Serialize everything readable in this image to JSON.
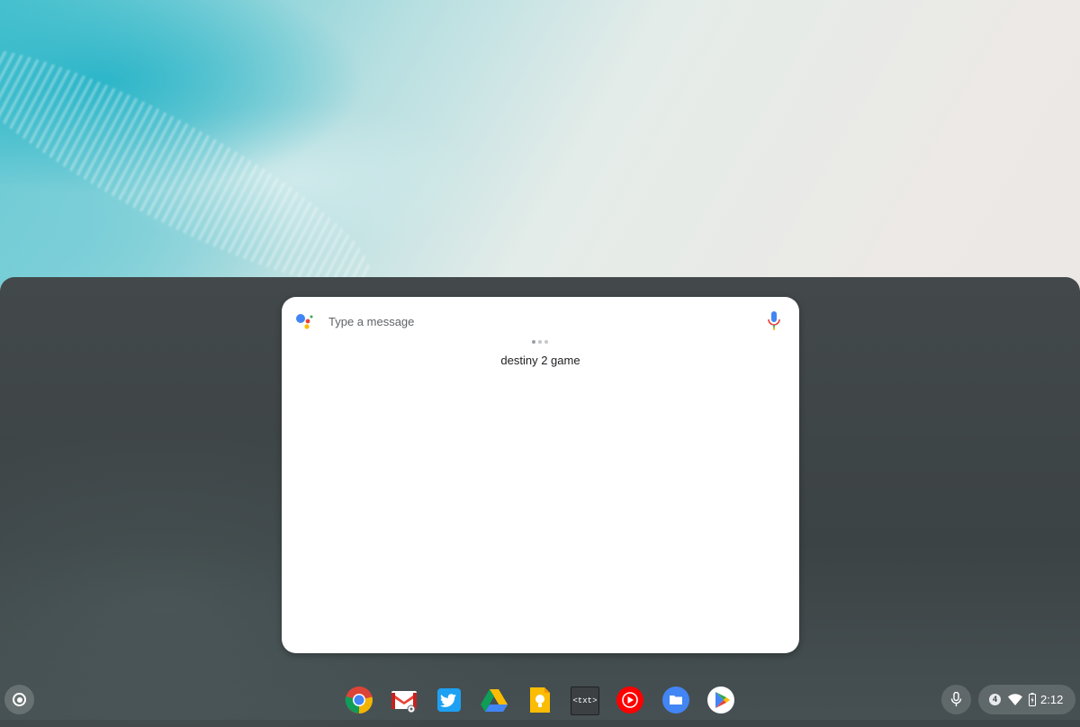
{
  "assistant": {
    "input_placeholder": "Type a message",
    "query": "destiny 2 game",
    "mic_icon": "mic-icon",
    "logo_icon": "google-assistant-icon"
  },
  "shelf": {
    "launcher_icon": "launcher-circle-icon",
    "apps": [
      {
        "name": "Chrome",
        "icon": "chrome-icon"
      },
      {
        "name": "Gmail",
        "icon": "gmail-icon"
      },
      {
        "name": "Twitter",
        "icon": "twitter-icon"
      },
      {
        "name": "Google Drive",
        "icon": "drive-icon"
      },
      {
        "name": "Google Keep",
        "icon": "keep-icon"
      },
      {
        "name": "Text",
        "icon": "text-editor-icon",
        "label": "<txt>"
      },
      {
        "name": "YouTube Music",
        "icon": "youtube-music-icon"
      },
      {
        "name": "Files",
        "icon": "files-icon"
      },
      {
        "name": "Play Store",
        "icon": "play-store-icon"
      }
    ]
  },
  "status": {
    "notification_count": "4",
    "time": "2:12",
    "wifi_icon": "wifi-icon",
    "battery_icon": "battery-icon"
  },
  "colors": {
    "google_blue": "#4285f4",
    "google_red": "#ea4335",
    "google_yellow": "#fbbc04",
    "google_green": "#34a853"
  }
}
